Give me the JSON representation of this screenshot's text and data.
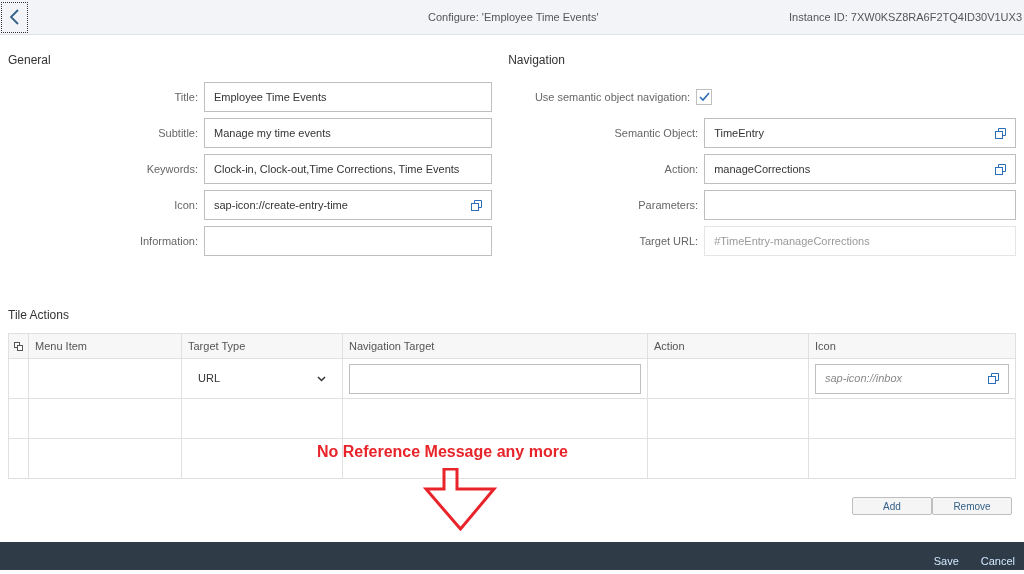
{
  "header": {
    "title": "Configure: 'Employee Time Events'",
    "instance_id": "Instance ID: 7XW0KSZ8RA6F2TQ4ID30V1UX3"
  },
  "general": {
    "heading": "General",
    "fields": [
      {
        "label": "Title:",
        "value": "Employee Time Events"
      },
      {
        "label": "Subtitle:",
        "value": "Manage my time events"
      },
      {
        "label": "Keywords:",
        "value": "Clock-in, Clock-out,Time Corrections, Time Events"
      },
      {
        "label": "Icon:",
        "value": "sap-icon://create-entry-time",
        "value_help": true
      },
      {
        "label": "Information:"
      }
    ]
  },
  "navigation": {
    "heading": "Navigation",
    "checkbox": {
      "label": "Use semantic object navigation:",
      "checked": true
    },
    "fields": [
      {
        "label": "Semantic Object:",
        "value": "TimeEntry",
        "value_help": true
      },
      {
        "label": "Action:",
        "value": "manageCorrections",
        "value_help": true
      },
      {
        "label": "Parameters:"
      },
      {
        "label": "Target URL:",
        "value": "#TimeEntry-manageCorrections",
        "disabled": true
      }
    ]
  },
  "tile_actions": {
    "heading": "Tile Actions",
    "columns": [
      "Menu Item",
      "Target Type",
      "Navigation Target",
      "Action",
      "Icon"
    ],
    "rows": [
      {
        "cells": [
          {
            "kind": "blank"
          },
          {
            "kind": "select",
            "value": "URL"
          },
          {
            "kind": "input"
          },
          {
            "kind": "blank"
          },
          {
            "kind": "icon_input",
            "placeholder": "sap-icon://inbox"
          }
        ]
      },
      {
        "cells": [
          {
            "kind": "blank"
          },
          {
            "kind": "blank"
          },
          {
            "kind": "blank"
          },
          {
            "kind": "blank"
          },
          {
            "kind": "blank"
          }
        ]
      },
      {
        "cells": [
          {
            "kind": "blank"
          },
          {
            "kind": "blank"
          },
          {
            "kind": "blank"
          },
          {
            "kind": "blank"
          },
          {
            "kind": "blank"
          }
        ]
      }
    ],
    "buttons": [
      "Add",
      "Remove"
    ]
  },
  "annotation": "No Reference Message any more",
  "footer": {
    "buttons": [
      "Save",
      "Cancel"
    ]
  }
}
